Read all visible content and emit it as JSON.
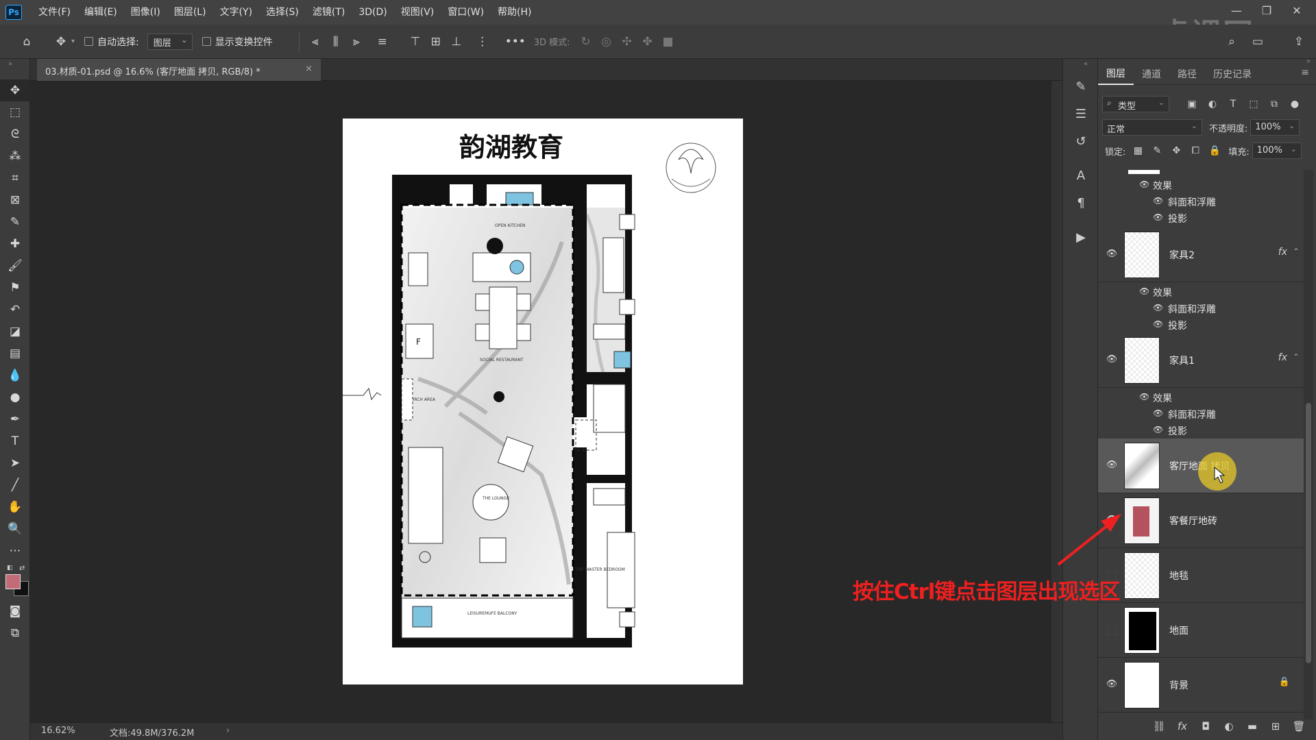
{
  "app": {
    "logo": "Ps"
  },
  "menu": [
    "文件(F)",
    "编辑(E)",
    "图像(I)",
    "图层(L)",
    "文字(Y)",
    "选择(S)",
    "滤镜(T)",
    "3D(D)",
    "视图(V)",
    "窗口(W)",
    "帮助(H)"
  ],
  "options": {
    "auto_select_label": "自动选择:",
    "auto_select_value": "图层",
    "show_transform_label": "显示变换控件",
    "mode_3d_label": "3D 模式:"
  },
  "document": {
    "tab_title": "03.材质-01.psd @ 16.6% (客厅地面 拷贝, RGB/8) *",
    "zoom": "16.62%",
    "doc_size": "文档:49.8M/376.2M",
    "artwork_title": "韵湖教育",
    "plan_labels": [
      "OPEN KITCHEN",
      "SOCIAL RESTAURANT",
      "PORCH AREA",
      "THE LOUNGE",
      "LEISUREMUFE BALCONY",
      "THE MASTER BEDROOM",
      "F"
    ]
  },
  "panel": {
    "tabs": [
      "图层",
      "通道",
      "路径",
      "历史记录"
    ],
    "filter_type": "类型",
    "blend_mode": "正常",
    "opacity_label": "不透明度:",
    "opacity_value": "100%",
    "lock_label": "锁定:",
    "fill_label": "填充:",
    "fill_value": "100%"
  },
  "layers": {
    "top_effects": {
      "effects": "效果",
      "bevel": "斜面和浮雕",
      "shadow": "投影"
    },
    "items": [
      {
        "name": "家具2",
        "fx": "fx",
        "effects": "效果",
        "bevel": "斜面和浮雕",
        "shadow": "投影"
      },
      {
        "name": "家具1",
        "fx": "fx",
        "effects": "效果",
        "bevel": "斜面和浮雕",
        "shadow": "投影"
      },
      {
        "name": "客厅地面 拷贝",
        "selected": true
      },
      {
        "name": "客餐厅地砖"
      },
      {
        "name": "地毯"
      },
      {
        "name": "地面"
      },
      {
        "name": "背景"
      }
    ]
  },
  "annotation": "按住Ctrl键点击图层出现选区",
  "watermark": "虎课网",
  "colors": {
    "accent_red": "#ee2020",
    "fg_swatch": "#c46b78",
    "tile_thumb": "#b4525e"
  }
}
